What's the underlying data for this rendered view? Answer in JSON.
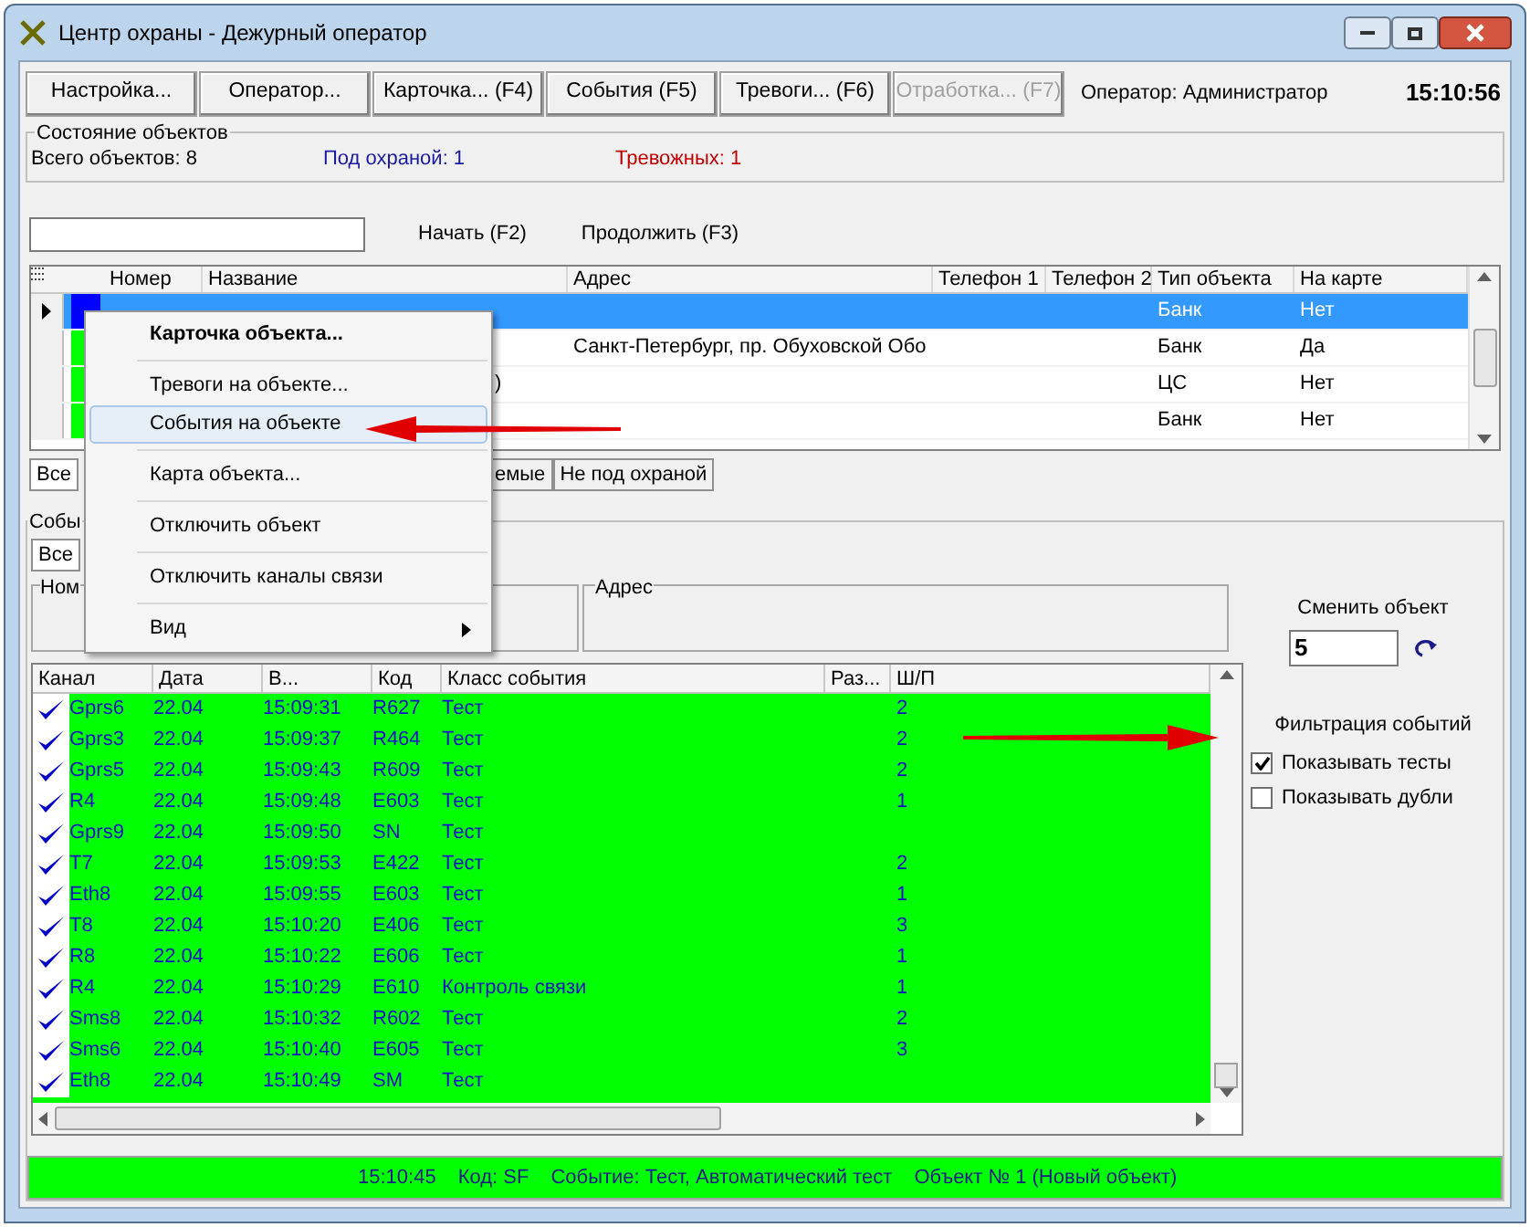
{
  "window": {
    "title": "Центр охраны - Дежурный оператор"
  },
  "toolbar": {
    "buttons": [
      {
        "label": "Настройка...",
        "disabled": false
      },
      {
        "label": "Оператор...",
        "disabled": false
      },
      {
        "label": "Карточка... (F4)",
        "disabled": false
      },
      {
        "label": "События (F5)",
        "disabled": false
      },
      {
        "label": "Тревоги... (F6)",
        "disabled": false
      },
      {
        "label": "Отработка... (F7)",
        "disabled": true
      }
    ],
    "operator": "Оператор: Администратор",
    "clock": "15:10:56"
  },
  "objects_state": {
    "title": "Состояние объектов",
    "total": "Всего объектов: 8",
    "guarded": "Под охраной: 1",
    "alarms": "Тревожных: 1"
  },
  "search": {
    "buttons": [
      "Начать (F2)",
      "Продолжить (F3)"
    ]
  },
  "objects_table": {
    "columns": [
      "Номер",
      "Название",
      "Адрес",
      "Телефон 1",
      "Телефон 2",
      "Тип объекта",
      "На карте"
    ],
    "rows": [
      {
        "selected": true,
        "color": "#0000ff",
        "name": "",
        "address": "",
        "type": "Банк",
        "on_map": "Нет"
      },
      {
        "selected": false,
        "color": "#00ff00",
        "name": "",
        "address": "Санкт-Петербург, пр. Обуховской Обо",
        "type": "Банк",
        "on_map": "Да"
      },
      {
        "selected": false,
        "color": "#00ff00",
        "name": ")",
        "address": "",
        "type": "ЦС",
        "on_map": "Нет"
      },
      {
        "selected": false,
        "color": "#00ff00",
        "name": "",
        "address": "",
        "type": "Банк",
        "on_map": "Нет"
      }
    ]
  },
  "object_tabs": [
    {
      "label": "Все",
      "selected": true
    },
    {
      "label": "емые",
      "selected": false
    },
    {
      "label": "Не под охраной",
      "selected": false
    }
  ],
  "events": {
    "title": "Собы",
    "tabs": [
      {
        "label": "Все",
        "selected": true
      }
    ],
    "number_group": "Ном",
    "address_group": "Адрес",
    "columns": [
      "Канал",
      "Дата",
      "В...",
      "Код",
      "Класс события",
      "Раз...",
      "Ш/П"
    ],
    "rows": [
      {
        "channel": "Gprs6",
        "date": "22.04",
        "time": "15:09:31",
        "code": "R627",
        "class": "Тест",
        "sp": "2"
      },
      {
        "channel": "Gprs3",
        "date": "22.04",
        "time": "15:09:37",
        "code": "R464",
        "class": "Тест",
        "sp": "2"
      },
      {
        "channel": "Gprs5",
        "date": "22.04",
        "time": "15:09:43",
        "code": "R609",
        "class": "Тест",
        "sp": "2"
      },
      {
        "channel": "R4",
        "date": "22.04",
        "time": "15:09:48",
        "code": "E603",
        "class": "Тест",
        "sp": "1"
      },
      {
        "channel": "Gprs9",
        "date": "22.04",
        "time": "15:09:50",
        "code": "SN",
        "class": "Тест",
        "sp": ""
      },
      {
        "channel": "T7",
        "date": "22.04",
        "time": "15:09:53",
        "code": "E422",
        "class": "Тест",
        "sp": "2"
      },
      {
        "channel": "Eth8",
        "date": "22.04",
        "time": "15:09:55",
        "code": "E603",
        "class": "Тест",
        "sp": "1"
      },
      {
        "channel": "T8",
        "date": "22.04",
        "time": "15:10:20",
        "code": "E406",
        "class": "Тест",
        "sp": "3"
      },
      {
        "channel": "R8",
        "date": "22.04",
        "time": "15:10:22",
        "code": "E606",
        "class": "Тест",
        "sp": "1"
      },
      {
        "channel": "R4",
        "date": "22.04",
        "time": "15:10:29",
        "code": "E610",
        "class": "Контроль связи",
        "sp": "1"
      },
      {
        "channel": "Sms8",
        "date": "22.04",
        "time": "15:10:32",
        "code": "R602",
        "class": "Тест",
        "sp": "2"
      },
      {
        "channel": "Sms6",
        "date": "22.04",
        "time": "15:10:40",
        "code": "E605",
        "class": "Тест",
        "sp": "3"
      },
      {
        "channel": "Eth8",
        "date": "22.04",
        "time": "15:10:49",
        "code": "SM",
        "class": "Тест",
        "sp": ""
      }
    ]
  },
  "change_object": {
    "label": "Сменить объект",
    "value": "5"
  },
  "filter": {
    "title": "Фильтрация событий",
    "options": [
      {
        "label": "Показывать тесты",
        "checked": true
      },
      {
        "label": "Показывать дубли",
        "checked": false
      }
    ]
  },
  "status_bar": {
    "time": "15:10:45",
    "code": "Код: SF",
    "event": "Событие: Тест, Автоматический тест",
    "object": "Объект № 1 (Новый объект)"
  },
  "context_menu": {
    "items": [
      {
        "kind": "item",
        "label": "Карточка объекта...",
        "bold": true,
        "selected": false,
        "submenu": false
      },
      {
        "kind": "separator"
      },
      {
        "kind": "item",
        "label": "Тревоги на объекте...",
        "bold": false,
        "selected": false,
        "submenu": false
      },
      {
        "kind": "item",
        "label": "События на объекте",
        "bold": false,
        "selected": true,
        "submenu": false
      },
      {
        "kind": "separator"
      },
      {
        "kind": "item",
        "label": "Карта объекта...",
        "bold": false,
        "selected": false,
        "submenu": false
      },
      {
        "kind": "separator"
      },
      {
        "kind": "item",
        "label": "Отключить объект",
        "bold": false,
        "selected": false,
        "submenu": false
      },
      {
        "kind": "separator"
      },
      {
        "kind": "item",
        "label": "Отключить каналы связи",
        "bold": false,
        "selected": false,
        "submenu": false
      },
      {
        "kind": "separator"
      },
      {
        "kind": "item",
        "label": "Вид",
        "bold": false,
        "selected": false,
        "submenu": true
      }
    ]
  }
}
